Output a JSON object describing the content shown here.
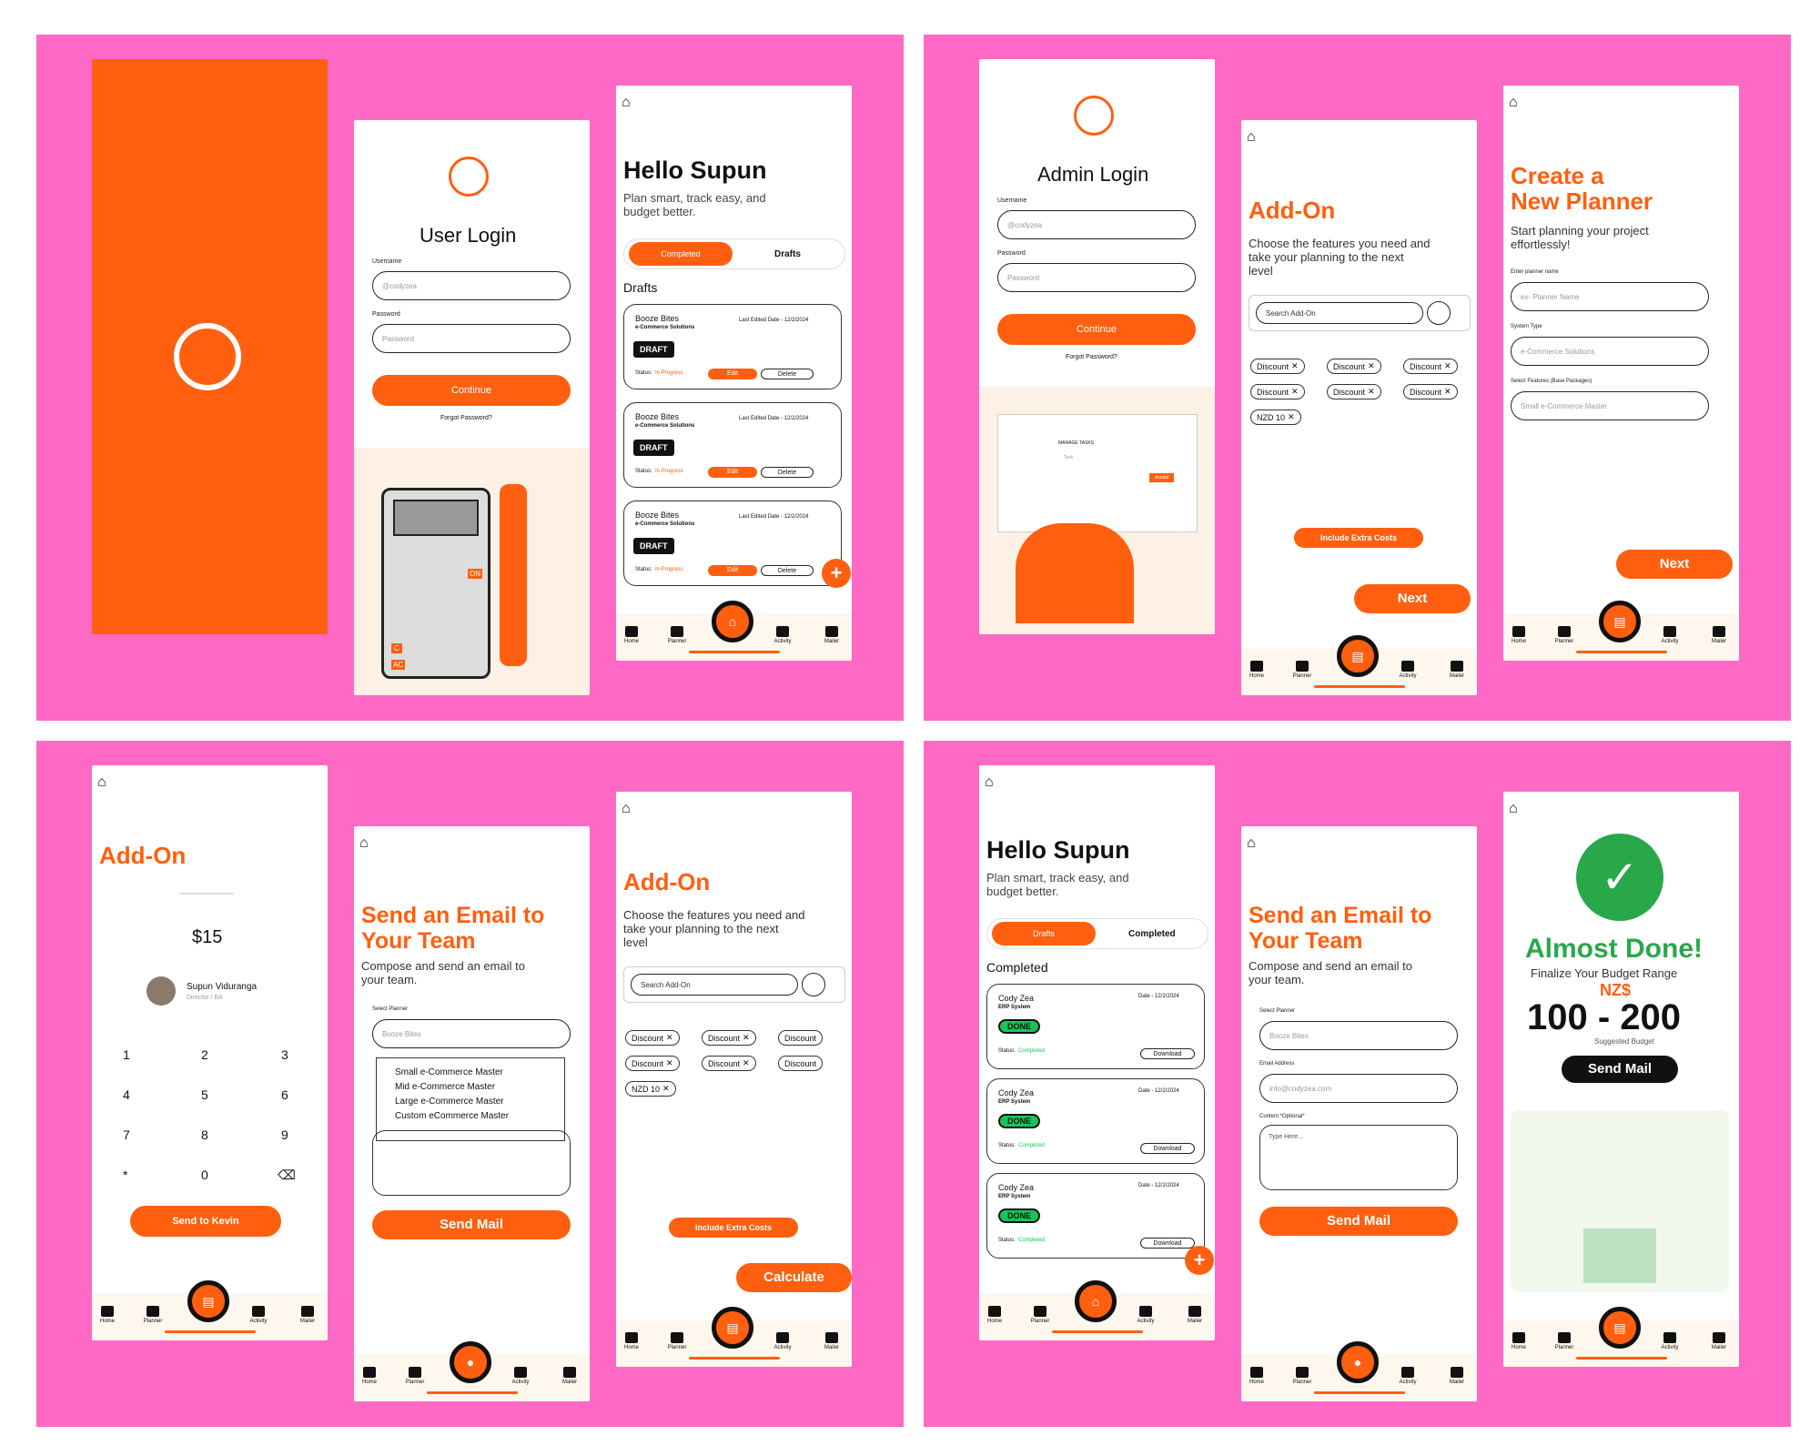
{
  "colors": {
    "pink": "#ff69c6",
    "orange": "#ff5f0f",
    "dark": "#111111"
  },
  "user_login": {
    "title": "User Login",
    "username_label": "Username",
    "username_ph": "@codyzea",
    "password_label": "Password",
    "password_ph": "Password",
    "continue": "Continue",
    "forgot": "Forgot Password?",
    "calc_on": "ON",
    "calc_ac": "AC",
    "calc_c": "C"
  },
  "home": {
    "greeting": "Hello Supun",
    "sub": "Plan smart, track easy, and budget better.",
    "tab_completed": "Completed",
    "tab_drafts": "Drafts",
    "section": "Drafts",
    "cards": [
      {
        "name": "Booze Bites",
        "company": "e-Commerce Solutions",
        "date": "Last Edited Date - 12/2/2024",
        "badge": "DRAFT",
        "status_label": "Status:",
        "status": "In Progress",
        "edit": "Edit",
        "delete": "Delete"
      },
      {
        "name": "Booze Bites",
        "company": "e-Commerce Solutions",
        "date": "Last Edited Date - 12/2/2024",
        "badge": "DRAFT",
        "status_label": "Status:",
        "status": "In Progress",
        "edit": "Edit",
        "delete": "Delete"
      },
      {
        "name": "Booze Bites",
        "company": "e-Commerce Solutions",
        "date": "Last Edited Date - 12/2/2024",
        "badge": "DRAFT",
        "status_label": "Status:",
        "status": "In Progress",
        "edit": "Edit",
        "delete": "Delete"
      }
    ]
  },
  "nav": {
    "home": "Home",
    "planner": "Planner",
    "activity": "Activity",
    "mailer": "Mailer"
  },
  "admin_login": {
    "title": "Admin Login",
    "username_label": "Username",
    "username_ph": "@codyzea",
    "password_label": "Password",
    "password_ph": "Password",
    "continue": "Continue",
    "forgot": "Forgot Password?",
    "manage_tasks": "MANAGE TASKS",
    "task": "Task",
    "accept": "Accept"
  },
  "addon1": {
    "title": "Add-On",
    "sub": "Choose the features you need and take your planning to the next level",
    "search_ph": "Search Add-On",
    "chips": [
      "Discount",
      "Discount",
      "Discount",
      "Discount",
      "Discount",
      "Discount",
      "NZD 10"
    ],
    "extra": "Include Extra Costs",
    "next": "Next"
  },
  "create": {
    "title1": "Create a",
    "title2": "New Planner",
    "sub": "Start planning your project effortlessly!",
    "name_label": "Enter planner name",
    "name_ph": "ex- Planner Name",
    "type_label": "System Type",
    "type_val": "e-Commerce Solutions",
    "feat_label": "Select Features (Base Packages)",
    "feat_val": "Small e-Commerce Master",
    "next": "Next"
  },
  "pay": {
    "title": "Add-On",
    "amount": "$15",
    "user": "Supun Viduranga",
    "role": "Director / BA",
    "keys": [
      "1",
      "2",
      "3",
      "4",
      "5",
      "6",
      "7",
      "8",
      "9",
      "*",
      "0",
      "⌫"
    ],
    "send": "Send to Kevin"
  },
  "email1": {
    "title1": "Send an Email to",
    "title2": "Your Team",
    "sub": "Compose and send an email to your team.",
    "planner_label": "Select Planner",
    "planner_val": "Booze Bites",
    "options": [
      "Small e-Commerce Master",
      "Mid e-Commerce Master",
      "Large e-Commerce Master",
      "Custom eCommerce Master"
    ],
    "send": "Send Mail"
  },
  "addon2": {
    "title": "Add-On",
    "sub": "Choose the features you need and take your planning to the next level",
    "search_ph": "Search Add-On",
    "chips": [
      "Discount",
      "Discount",
      "Discount",
      "Discount",
      "Discount",
      "Discount",
      "NZD 10"
    ],
    "extra": "Include Extra Costs",
    "calc": "Calculate"
  },
  "home2": {
    "greeting": "Hello Supun",
    "sub": "Plan smart, track easy, and budget better.",
    "tab_drafts": "Drafts",
    "tab_completed": "Completed",
    "section": "Completed",
    "cards": [
      {
        "name": "Cody Zea",
        "company": "ERP System",
        "date": "Date - 12/2/2024",
        "badge": "DONE",
        "status_label": "Status:",
        "status": "Completed",
        "download": "Download"
      },
      {
        "name": "Cody Zea",
        "company": "ERP System",
        "date": "Date - 12/2/2024",
        "badge": "DONE",
        "status_label": "Status:",
        "status": "Completed",
        "download": "Download"
      },
      {
        "name": "Cody Zea",
        "company": "ERP System",
        "date": "Date - 12/2/2024",
        "badge": "DONE",
        "status_label": "Status:",
        "status": "Completed",
        "download": "Download"
      }
    ]
  },
  "email2": {
    "title1": "Send an Email to",
    "title2": "Your Team",
    "sub": "Compose and send an email to your team.",
    "planner_label": "Select Planner",
    "planner_val": "Booze Bites",
    "email_label": "Email Address",
    "email_ph": "info@codyzea.com",
    "content_label": "Content *Optional*",
    "content_ph": "Type Here...",
    "send": "Send Mail"
  },
  "done": {
    "title": "Almost Done!",
    "sub": "Finalize Your Budget Range",
    "currency": "NZ$",
    "range": "100 - 200",
    "suggested": "Suggested Budget",
    "send": "Send Mail"
  }
}
